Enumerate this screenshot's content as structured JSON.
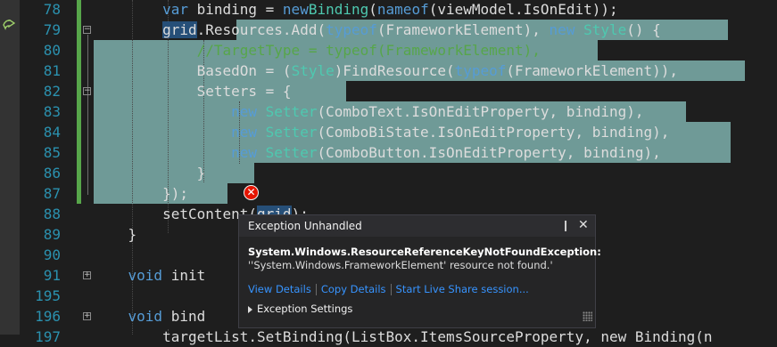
{
  "editor": {
    "lines": [
      {
        "num": "78",
        "prefix": "        ",
        "segments": [
          [
            "kw",
            "var"
          ],
          [
            "",
            "binding = "
          ],
          [
            "kw",
            "new"
          ],
          [
            "",
            ""
          ],
          [
            "ty",
            "Binding"
          ],
          [
            "",
            "("
          ],
          [
            "kw",
            "nameof"
          ],
          [
            "",
            "(viewModel.IsOnEdit));"
          ]
        ]
      },
      {
        "num": "79",
        "prefix": "        ",
        "segments": [
          [
            "hl",
            "grid"
          ],
          [
            "",
            ".Resources.Add("
          ],
          [
            "kw",
            "typeof"
          ],
          [
            "",
            "(FrameworkElement), "
          ],
          [
            "kw",
            "new"
          ],
          [
            "ty",
            "Style"
          ],
          [
            "",
            "() {"
          ]
        ]
      },
      {
        "num": "80",
        "prefix": "            ",
        "segments": [
          [
            "cm",
            "//TargetType = typeof(FrameworkElement),"
          ]
        ]
      },
      {
        "num": "81",
        "prefix": "            ",
        "segments": [
          [
            "",
            "BasedOn = ("
          ],
          [
            "ty",
            "Style"
          ],
          [
            "",
            ")FindResource("
          ],
          [
            "kw",
            "typeof"
          ],
          [
            "",
            "(FrameworkElement)),"
          ]
        ]
      },
      {
        "num": "82",
        "prefix": "            ",
        "segments": [
          [
            "",
            "Setters = {"
          ]
        ]
      },
      {
        "num": "83",
        "prefix": "                ",
        "segments": [
          [
            "kw",
            "new"
          ],
          [
            "ty",
            "Setter"
          ],
          [
            "",
            "(ComboText.IsOnEditProperty, binding),"
          ]
        ]
      },
      {
        "num": "84",
        "prefix": "                ",
        "segments": [
          [
            "kw",
            "new"
          ],
          [
            "ty",
            "Setter"
          ],
          [
            "",
            "(ComboBiState.IsOnEditProperty, binding),"
          ]
        ]
      },
      {
        "num": "85",
        "prefix": "                ",
        "segments": [
          [
            "kw",
            "new"
          ],
          [
            "ty",
            "Setter"
          ],
          [
            "",
            "(ComboButton.IsOnEditProperty, binding),"
          ]
        ]
      },
      {
        "num": "86",
        "prefix": "            ",
        "segments": [
          [
            "",
            "}"
          ]
        ]
      },
      {
        "num": "87",
        "prefix": "        ",
        "segments": [
          [
            "",
            "});"
          ]
        ]
      },
      {
        "num": "88",
        "prefix": "        ",
        "segments": [
          [
            "",
            "setContent("
          ],
          [
            "hl",
            "grid"
          ],
          [
            "",
            ");"
          ]
        ]
      },
      {
        "num": "89",
        "prefix": "    ",
        "segments": [
          [
            "",
            "}"
          ]
        ]
      },
      {
        "num": "90",
        "prefix": "",
        "segments": []
      },
      {
        "num": "91",
        "prefix": "    ",
        "segments": [
          [
            "kw",
            "void"
          ],
          [
            "",
            "init"
          ]
        ]
      },
      {
        "num": "195",
        "prefix": "",
        "segments": []
      },
      {
        "num": "196",
        "prefix": "    ",
        "segments": [
          [
            "kw",
            "void"
          ],
          [
            "",
            "bind"
          ]
        ]
      },
      {
        "num": "197",
        "prefix": "        ",
        "segments": [
          [
            "",
            "targetList.SetBinding(ListBox.ItemsSourceProperty, new Binding(n"
          ]
        ]
      }
    ]
  },
  "exception_popup": {
    "title": "Exception Unhandled",
    "pin_glyph": "❙",
    "close_glyph": "✕",
    "exception_type": "System.Windows.ResourceReferenceKeyNotFoundException:",
    "message": "''System.Windows.FrameworkElement' resource not found.'",
    "links": [
      "View Details",
      "Copy Details",
      "Start Live Share session..."
    ],
    "settings_label": "Exception Settings"
  },
  "colors": {
    "background": "#1e1e1e",
    "line_number": "#2b91af",
    "keyword": "#569cd6",
    "type": "#4ec9b0",
    "comment": "#57a64a",
    "selection": "#6f9a97",
    "error": "#e51400",
    "link": "#3794ff"
  },
  "icons": [
    "current-statement-arrow-icon",
    "error-icon",
    "pin-icon",
    "close-icon",
    "expand-caret-icon",
    "resize-grip-icon"
  ]
}
